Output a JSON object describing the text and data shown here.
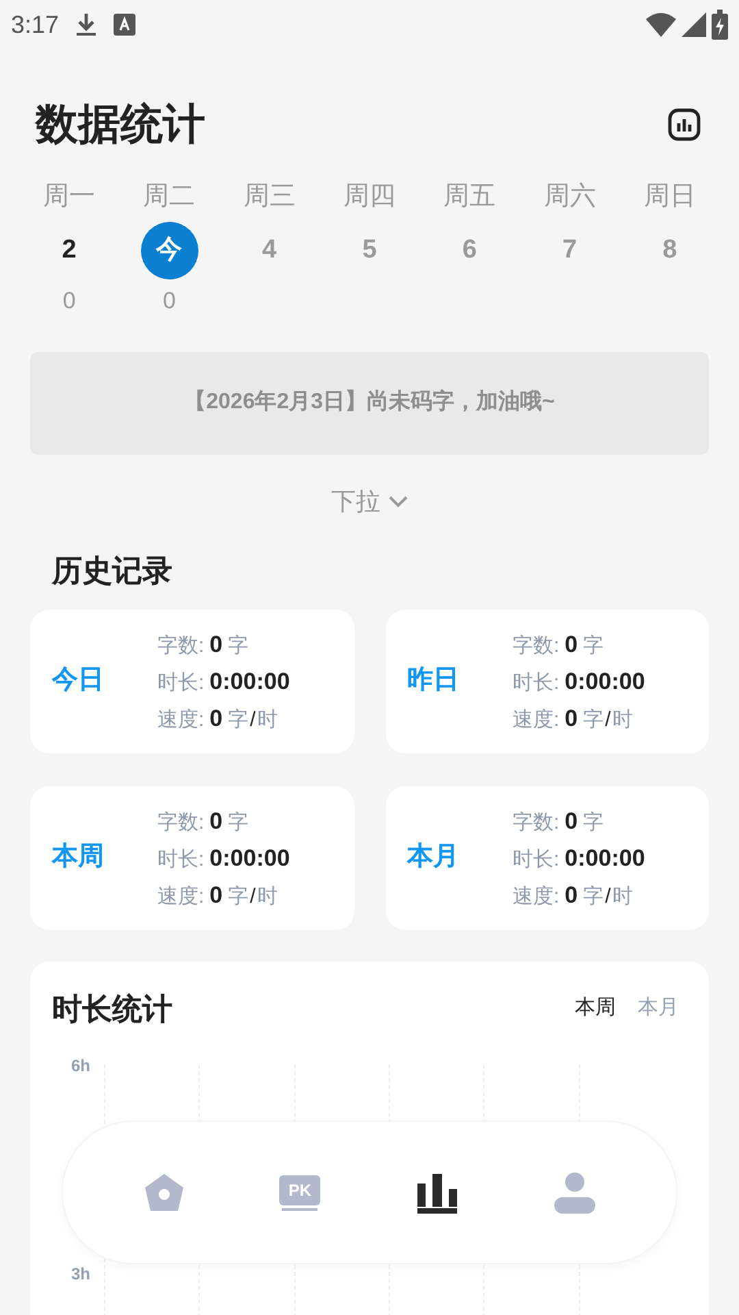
{
  "status_bar": {
    "time": "3:17"
  },
  "header": {
    "title": "数据统计"
  },
  "week": [
    {
      "name": "周一",
      "date": "2",
      "count": "0",
      "kind": "past",
      "selected": false
    },
    {
      "name": "周二",
      "date": "今",
      "count": "0",
      "kind": "today",
      "selected": true
    },
    {
      "name": "周三",
      "date": "4",
      "kind": "future",
      "selected": false
    },
    {
      "name": "周四",
      "date": "5",
      "kind": "future",
      "selected": false
    },
    {
      "name": "周五",
      "date": "6",
      "kind": "future",
      "selected": false
    },
    {
      "name": "周六",
      "date": "7",
      "kind": "future",
      "selected": false
    },
    {
      "name": "周日",
      "date": "8",
      "kind": "future",
      "selected": false
    }
  ],
  "notice": "【2026年2月3日】尚未码字，加油哦~",
  "pull_down": "下拉",
  "history": {
    "title": "历史记录",
    "cards": [
      {
        "period": "今日",
        "words_label": "字数:",
        "words": "0",
        "words_unit": "字",
        "duration_label": "时长:",
        "duration": "0:00:00",
        "speed_label": "速度:",
        "speed": "0",
        "speed_unit_a": "字",
        "speed_sep": "/",
        "speed_unit_b": "时"
      },
      {
        "period": "昨日",
        "words_label": "字数:",
        "words": "0",
        "words_unit": "字",
        "duration_label": "时长:",
        "duration": "0:00:00",
        "speed_label": "速度:",
        "speed": "0",
        "speed_unit_a": "字",
        "speed_sep": "/",
        "speed_unit_b": "时"
      },
      {
        "period": "本周",
        "words_label": "字数:",
        "words": "0",
        "words_unit": "字",
        "duration_label": "时长:",
        "duration": "0:00:00",
        "speed_label": "速度:",
        "speed": "0",
        "speed_unit_a": "字",
        "speed_sep": "/",
        "speed_unit_b": "时"
      },
      {
        "period": "本月",
        "words_label": "字数:",
        "words": "0",
        "words_unit": "字",
        "duration_label": "时长:",
        "duration": "0:00:00",
        "speed_label": "速度:",
        "speed": "0",
        "speed_unit_a": "字",
        "speed_sep": "/",
        "speed_unit_b": "时"
      }
    ]
  },
  "duration_stats": {
    "title": "时长统计",
    "tabs": [
      {
        "label": "本周",
        "selected": true
      },
      {
        "label": "本月",
        "selected": false
      }
    ],
    "y_ticks": [
      "6h",
      "3h"
    ]
  },
  "nav": [
    {
      "kind": "home",
      "selected": false
    },
    {
      "kind": "pk",
      "icon_text": "PK",
      "selected": false
    },
    {
      "kind": "stats",
      "selected": true
    },
    {
      "kind": "profile",
      "selected": false
    }
  ]
}
